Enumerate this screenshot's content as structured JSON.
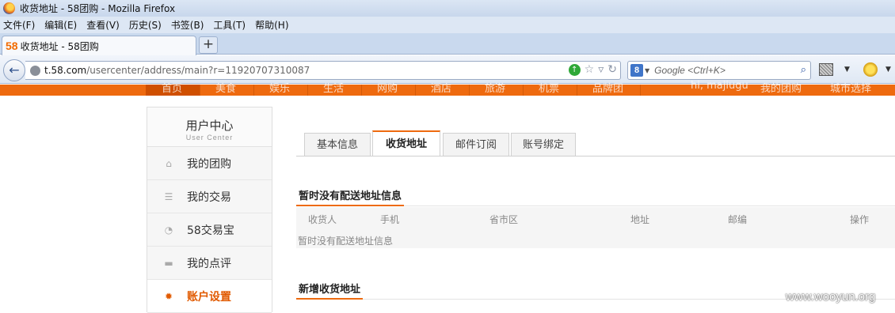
{
  "window": {
    "title": "收货地址 - 58团购 - Mozilla Firefox"
  },
  "menu": [
    "文件(F)",
    "编辑(E)",
    "查看(V)",
    "历史(S)",
    "书签(B)",
    "工具(T)",
    "帮助(H)"
  ],
  "tab": {
    "favicon": "58",
    "label": "收货地址 - 58团购",
    "new_tab": "+"
  },
  "urlbar": {
    "host": "t.58.com",
    "path": "/usercenter/address/main?r=11920707310087"
  },
  "searchbar": {
    "engine_icon": "8",
    "placeholder": "Google <Ctrl+K>"
  },
  "topnav": {
    "items": [
      "首页",
      "美食",
      "娱乐",
      "生活",
      "网购",
      "酒店",
      "旅游",
      "机票",
      "品牌团",
      "hi, majiugu",
      "我的团购",
      "城市选择"
    ]
  },
  "sidebar": {
    "title": "用户中心",
    "subtitle": "User Center",
    "items": [
      {
        "label": "我的团购",
        "icon": "home-icon"
      },
      {
        "label": "我的交易",
        "icon": "list-icon"
      },
      {
        "label": "58交易宝",
        "icon": "coins-icon"
      },
      {
        "label": "我的点评",
        "icon": "comment-icon"
      },
      {
        "label": "账户设置",
        "icon": "gear-icon",
        "active": true
      }
    ]
  },
  "tabs": [
    {
      "label": "基本信息"
    },
    {
      "label": "收货地址",
      "active": true
    },
    {
      "label": "邮件订阅"
    },
    {
      "label": "账号绑定"
    }
  ],
  "address_section": {
    "title": "暂时没有配送地址信息",
    "columns": [
      "收货人",
      "手机",
      "省市区",
      "地址",
      "邮编",
      "操作"
    ],
    "empty_message": "暂时没有配送地址信息"
  },
  "new_address_section": {
    "title": "新增收货地址"
  },
  "watermark": "www.wooyun.org",
  "colors": {
    "accent": "#ee6a0f",
    "browser_chrome": "#dde7f4"
  }
}
